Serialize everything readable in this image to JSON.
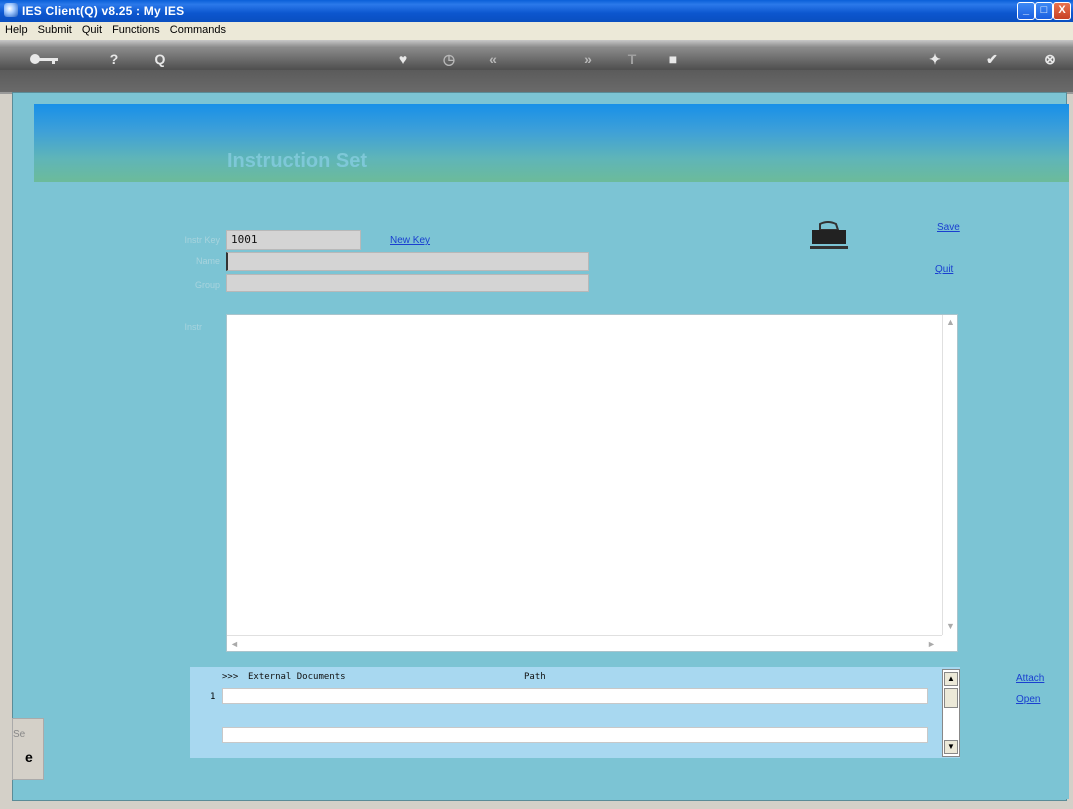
{
  "window": {
    "title": "IES Client(Q) v8.25 : My IES",
    "controls": {
      "minimize": "_",
      "maximize": "□",
      "close": "X"
    }
  },
  "menu": {
    "items": [
      "Help",
      "Submit",
      "Quit",
      "Functions",
      "Commands"
    ]
  },
  "toolbar": {
    "icons": [
      "key-icon",
      "help-icon",
      "search-icon",
      "heart-icon",
      "clock-icon",
      "rewind-icon",
      "forward-icon",
      "text-icon",
      "stop-icon",
      "refresh-icon",
      "check-icon",
      "close-icon"
    ],
    "help_glyph": "?",
    "search_glyph": "Q",
    "heart_glyph": "♥",
    "clock_glyph": "◷",
    "rewind_glyph": "«",
    "forward_glyph": "»",
    "text_glyph": "T",
    "stop_glyph": "■",
    "refresh_glyph": "✦",
    "check_glyph": "✔",
    "close_glyph": "⊗"
  },
  "banner": {
    "title": "Instruction Set"
  },
  "form": {
    "instr_key_label": "Instr Key",
    "instr_key_value": "1001",
    "new_key_link": "New Key",
    "name_label": "Name",
    "name_value": "",
    "group_label": "Group",
    "group_value": "",
    "instr_label": "Instr",
    "instr_value": ""
  },
  "actions": {
    "save": "Save",
    "quit": "Quit",
    "attach": "Attach",
    "open": "Open"
  },
  "external_documents": {
    "header_prefix": ">>>",
    "header_docs": "External Documents",
    "header_path": "Path",
    "rows": [
      {
        "index": "1",
        "doc": "",
        "path": ""
      },
      {
        "index": "",
        "doc": "",
        "path": ""
      }
    ]
  },
  "status": {
    "text": "Se"
  }
}
